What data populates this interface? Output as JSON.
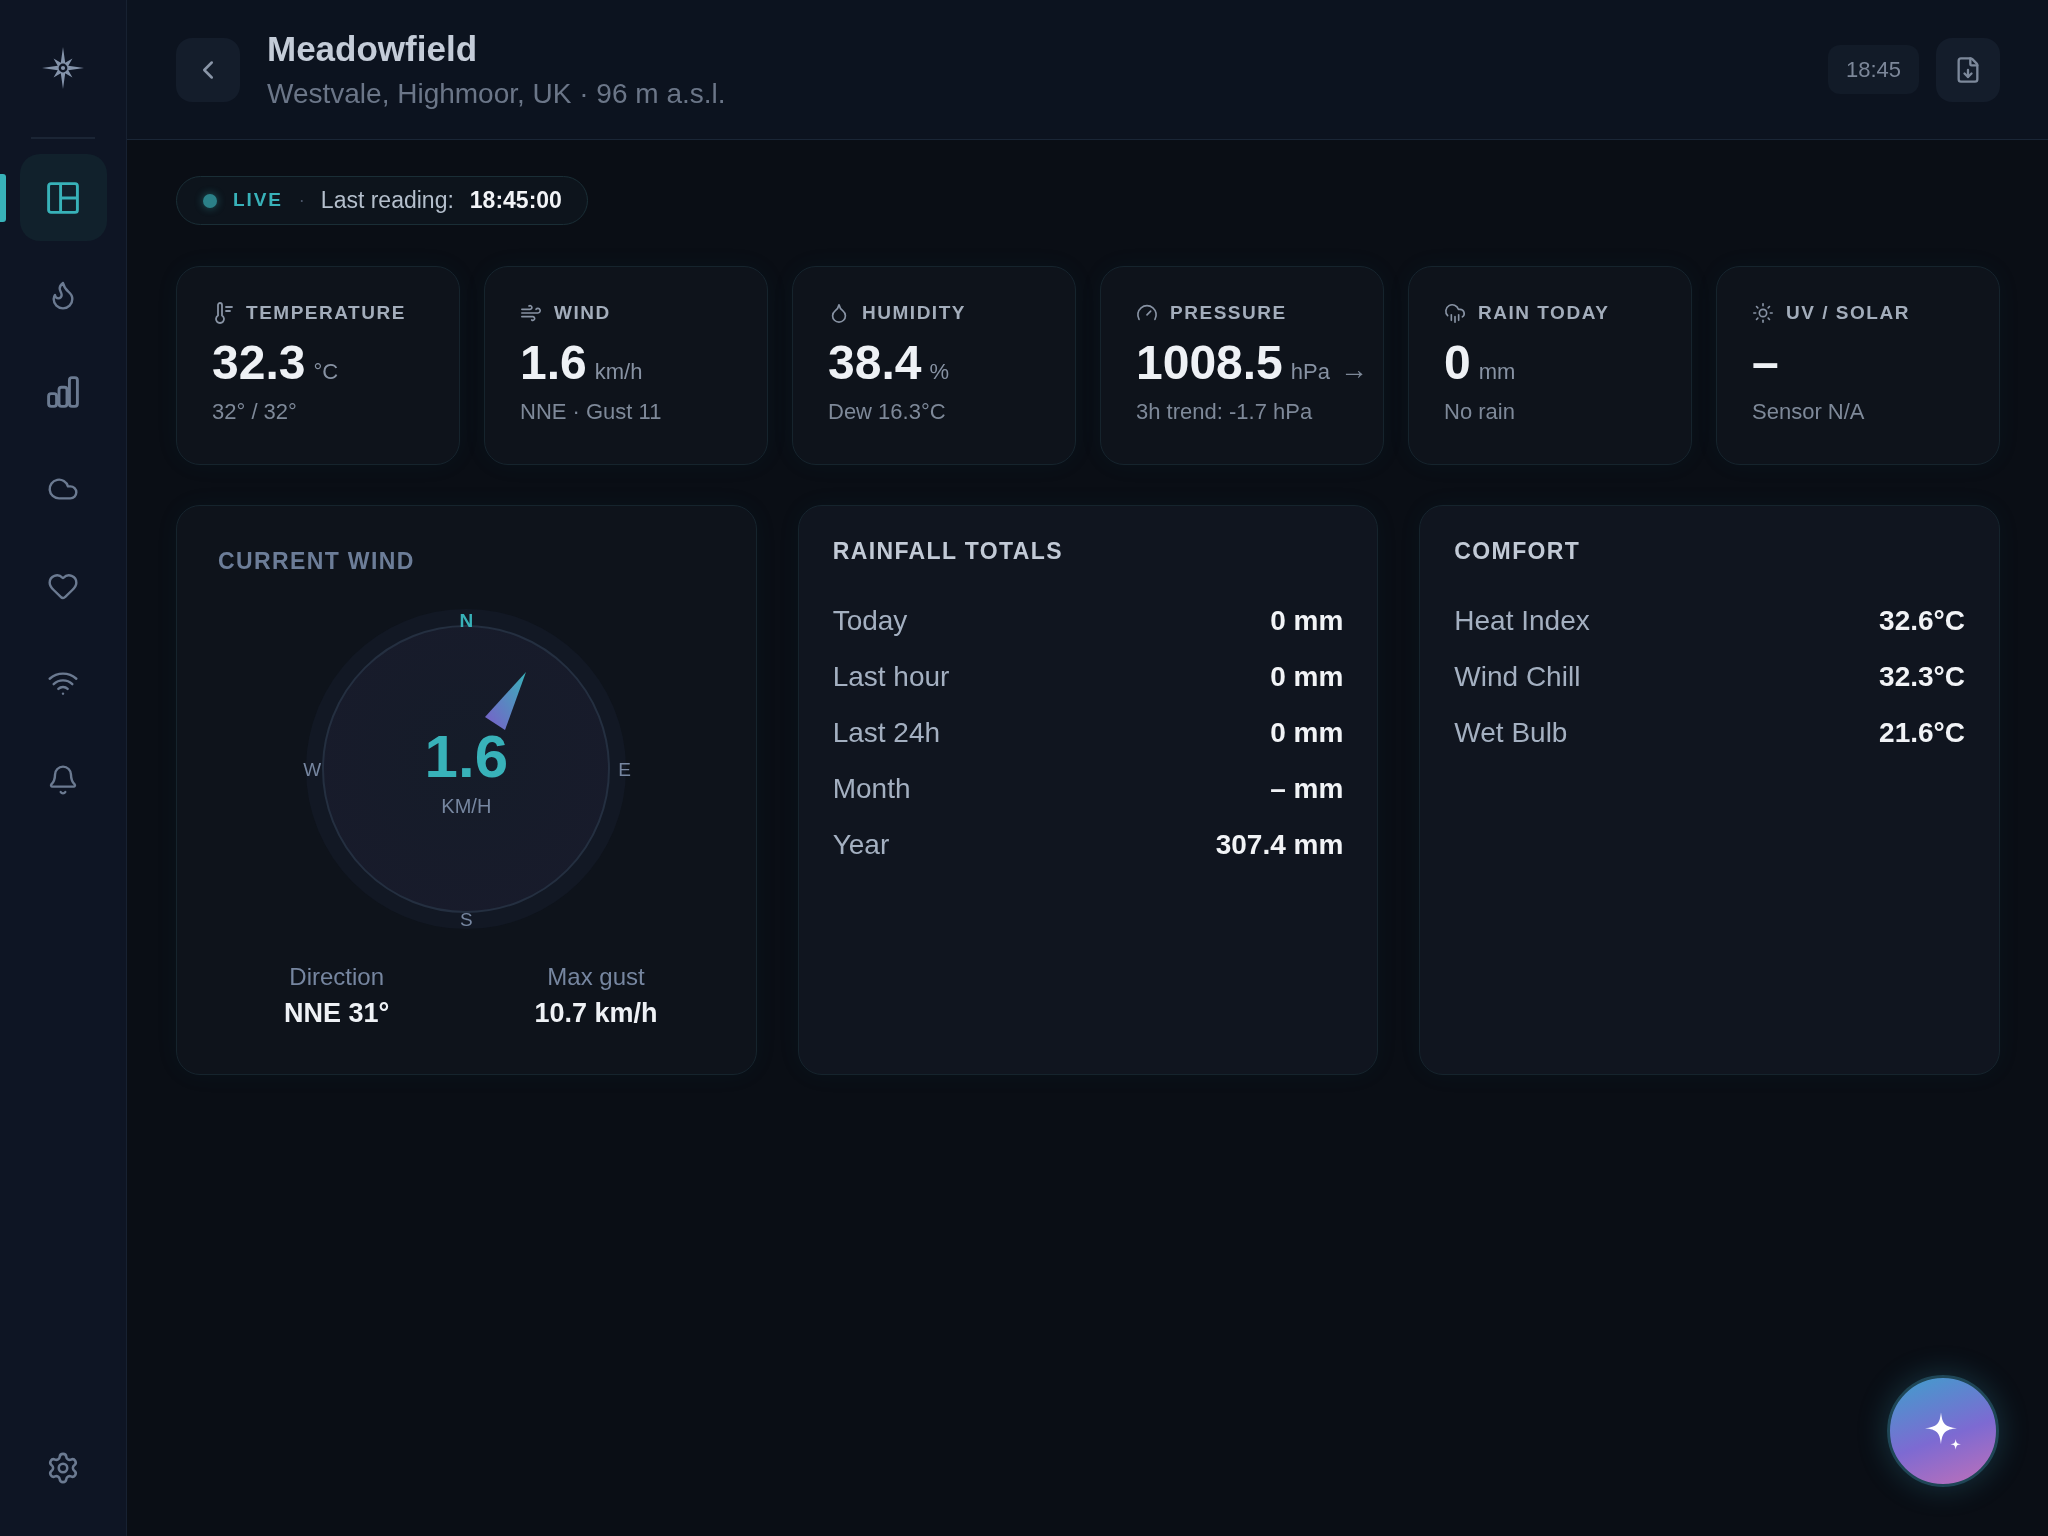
{
  "sidebar": {
    "items": [
      {
        "selected": true
      },
      {
        "selected": false
      },
      {
        "selected": false
      },
      {
        "selected": false
      },
      {
        "selected": false
      },
      {
        "selected": false
      },
      {
        "selected": false
      }
    ]
  },
  "header": {
    "title": "Meadowfield",
    "subtitle": "Westvale, Highmoor, UK · 96 m a.s.l.",
    "time": "18:45"
  },
  "status": {
    "live": "LIVE",
    "separator": "·",
    "label": "Last reading:",
    "value": "18:45:00"
  },
  "stats": [
    {
      "label": "TEMPERATURE",
      "value": "32.3",
      "unit": "°C",
      "detail": "32° / 32°"
    },
    {
      "label": "WIND",
      "value": "1.6",
      "unit": "km/h",
      "detail": "NNE · Gust 11"
    },
    {
      "label": "HUMIDITY",
      "value": "38.4",
      "unit": "%",
      "detail": "Dew 16.3°C"
    },
    {
      "label": "PRESSURE",
      "value": "1008.5",
      "unit": "hPa",
      "trend": "→",
      "detail": "3h trend: -1.7 hPa"
    },
    {
      "label": "RAIN TODAY",
      "value": "0",
      "unit": "mm",
      "detail": "No rain"
    },
    {
      "label": "UV / SOLAR",
      "value": "–",
      "detail": "Sensor N/A"
    }
  ],
  "wind": {
    "title": "CURRENT WIND",
    "compass": {
      "north": "N",
      "east": "E",
      "south": "S",
      "west": "W"
    },
    "speed": "1.6",
    "unit": "KM/H",
    "stats": [
      {
        "label": "Direction",
        "value": "NNE 31°"
      },
      {
        "label": "Max gust",
        "value": "10.7 km/h"
      }
    ]
  },
  "rainfall": {
    "title": "RAINFALL TOTALS",
    "rows": [
      {
        "label": "Today",
        "value": "0 mm"
      },
      {
        "label": "Last hour",
        "value": "0 mm"
      },
      {
        "label": "Last 24h",
        "value": "0 mm"
      },
      {
        "label": "Month",
        "value": "– mm"
      },
      {
        "label": "Year",
        "value": "307.4 mm"
      }
    ]
  },
  "comfort": {
    "title": "COMFORT",
    "rows": [
      {
        "label": "Heat Index",
        "value": "32.6°C"
      },
      {
        "label": "Wind Chill",
        "value": "32.3°C"
      },
      {
        "label": "Wet Bulb",
        "value": "21.6°C"
      }
    ]
  }
}
